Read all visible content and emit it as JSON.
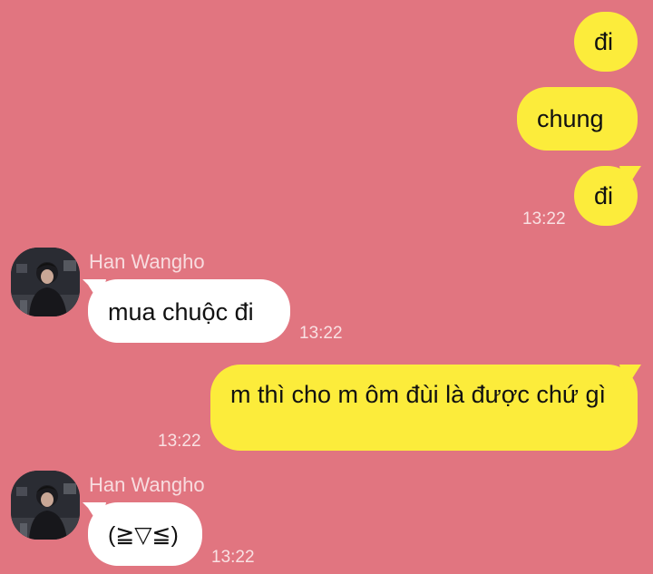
{
  "colors": {
    "background": "#e17580",
    "outgoing_bubble": "#fcec3b",
    "incoming_bubble": "#ffffff",
    "timestamp_text": "#f7d9dc",
    "sender_text": "#f5c8cd"
  },
  "messages": [
    {
      "direction": "outgoing",
      "text": "đi",
      "time": ""
    },
    {
      "direction": "outgoing",
      "text": "chung",
      "time": ""
    },
    {
      "direction": "outgoing",
      "text": "đi",
      "time": "13:22"
    },
    {
      "direction": "incoming",
      "sender": "Han Wangho",
      "avatar_icon": "user-avatar-photo",
      "text": "mua chuộc đi",
      "time": "13:22"
    },
    {
      "direction": "outgoing",
      "text": "m thì cho m ôm đùi là được chứ gì",
      "time": "13:22"
    },
    {
      "direction": "incoming",
      "sender": "Han Wangho",
      "avatar_icon": "user-avatar-photo",
      "text": "(≧▽≦)",
      "time": "13:22"
    }
  ]
}
